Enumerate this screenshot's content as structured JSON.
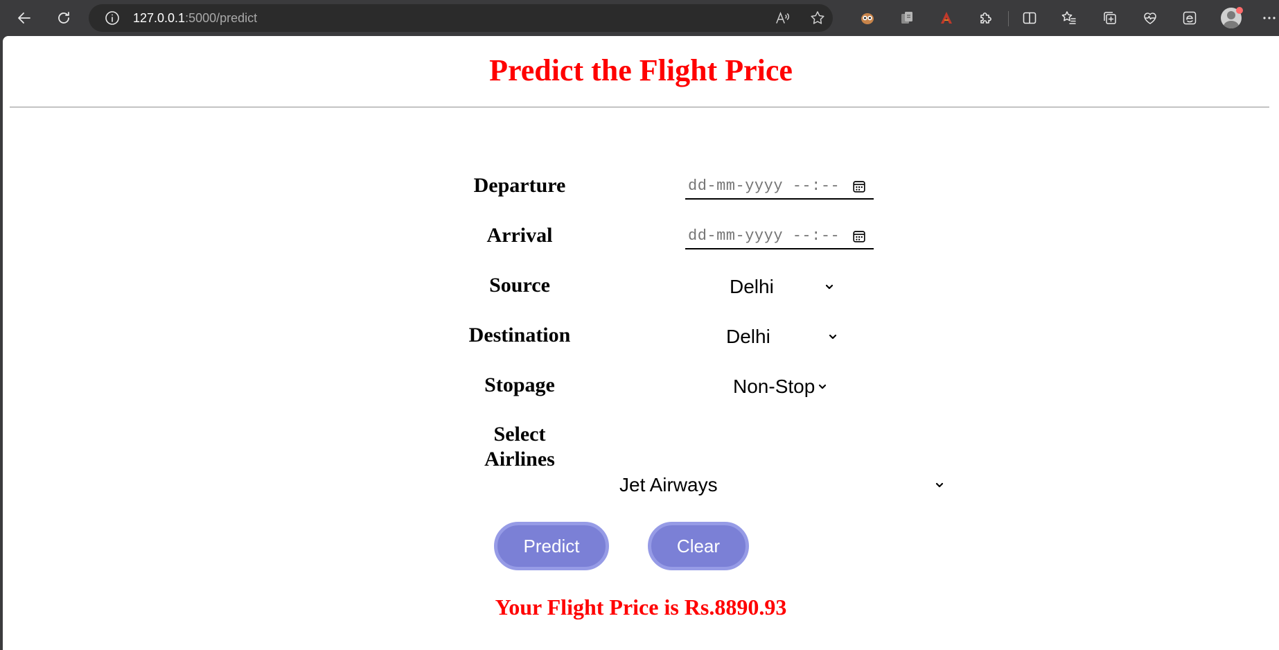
{
  "browser": {
    "url_host": "127.0.0.1",
    "url_path": ":5000/predict"
  },
  "page": {
    "title": "Predict the Flight Price",
    "accent_color": "#ff0000",
    "button_color": "#7b80d6"
  },
  "form": {
    "departure": {
      "label": "Departure",
      "placeholder": "dd-mm-yyyy --:--"
    },
    "arrival": {
      "label": "Arrival",
      "placeholder": "dd-mm-yyyy --:--"
    },
    "source": {
      "label": "Source",
      "value": "Delhi"
    },
    "destination": {
      "label": "Destination",
      "value": "Delhi"
    },
    "stopage": {
      "label": "Stopage",
      "value": "Non-Stop"
    },
    "airline": {
      "label_line1": "Select",
      "label_line2": "Airlines",
      "value": "Jet Airways"
    },
    "predict_label": "Predict",
    "clear_label": "Clear"
  },
  "result": {
    "text": "Your Flight Price is Rs.8890.93"
  }
}
